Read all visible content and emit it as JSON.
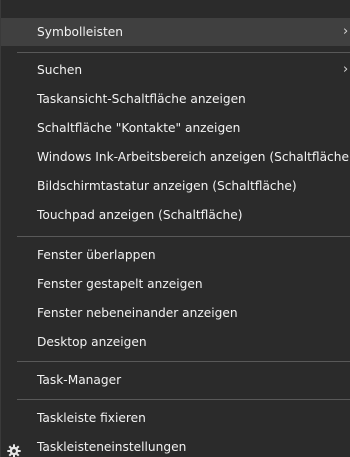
{
  "menu": {
    "items": [
      {
        "label": "Symbolleisten"
      },
      {
        "label": "Suchen"
      },
      {
        "label": "Taskansicht-Schaltfläche anzeigen"
      },
      {
        "label": "Schaltfläche \"Kontakte\" anzeigen"
      },
      {
        "label": "Windows Ink-Arbeitsbereich anzeigen (Schaltfläche)"
      },
      {
        "label": "Bildschirmtastatur anzeigen (Schaltfläche)"
      },
      {
        "label": "Touchpad anzeigen (Schaltfläche)"
      },
      {
        "label": "Fenster überlappen"
      },
      {
        "label": "Fenster gestapelt anzeigen"
      },
      {
        "label": "Fenster nebeneinander anzeigen"
      },
      {
        "label": "Desktop anzeigen"
      },
      {
        "label": "Task-Manager"
      },
      {
        "label": "Taskleiste fixieren"
      },
      {
        "label": "Taskleisteneinstellungen"
      }
    ],
    "submenu_glyph": "›",
    "icons": {
      "settings": "gear-icon"
    },
    "colors": {
      "background": "#2b2b2b",
      "hover": "#404040",
      "separator": "#595959",
      "text": "#f2f2f2"
    }
  }
}
